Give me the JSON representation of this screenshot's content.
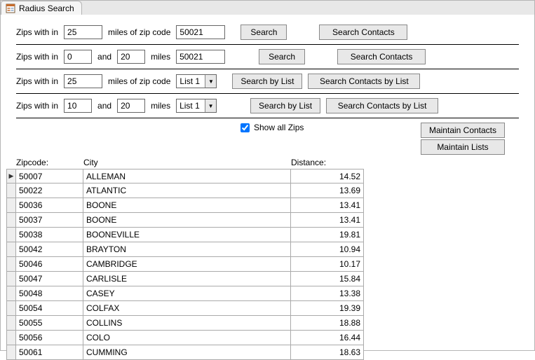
{
  "tab": {
    "title": "Radius Search"
  },
  "row1": {
    "label1": "Zips with in",
    "miles": "25",
    "label2": "miles of zip code",
    "zip": "50021",
    "search": "Search",
    "searchContacts": "Search Contacts"
  },
  "row2": {
    "label1": "Zips with in",
    "from": "0",
    "and": "and",
    "to": "20",
    "label2": "miles",
    "zip": "50021",
    "search": "Search",
    "searchContacts": "Search Contacts"
  },
  "row3": {
    "label1": "Zips with in",
    "miles": "25",
    "label2": "miles of zip code",
    "list": "List 1",
    "searchByList": "Search by List",
    "searchContactsByList": "Search Contacts by List"
  },
  "row4": {
    "label1": "Zips with in",
    "from": "10",
    "and": "and",
    "to": "20",
    "label2": "miles",
    "list": "List 1",
    "searchByList": "Search by List",
    "searchContactsByList": "Search Contacts by List"
  },
  "controls": {
    "showAll": "Show all Zips",
    "maintainContacts": "Maintain Contacts",
    "maintainLists": "Maintain Lists"
  },
  "headers": {
    "zip": "Zipcode:",
    "city": "City",
    "distance": "Distance:"
  },
  "rows": [
    {
      "zip": "50007",
      "city": "ALLEMAN",
      "dist": "14.52"
    },
    {
      "zip": "50022",
      "city": "ATLANTIC",
      "dist": "13.69"
    },
    {
      "zip": "50036",
      "city": "BOONE",
      "dist": "13.41"
    },
    {
      "zip": "50037",
      "city": "BOONE",
      "dist": "13.41"
    },
    {
      "zip": "50038",
      "city": "BOONEVILLE",
      "dist": "19.81"
    },
    {
      "zip": "50042",
      "city": "BRAYTON",
      "dist": "10.94"
    },
    {
      "zip": "50046",
      "city": "CAMBRIDGE",
      "dist": "10.17"
    },
    {
      "zip": "50047",
      "city": "CARLISLE",
      "dist": "15.84"
    },
    {
      "zip": "50048",
      "city": "CASEY",
      "dist": "13.38"
    },
    {
      "zip": "50054",
      "city": "COLFAX",
      "dist": "19.39"
    },
    {
      "zip": "50055",
      "city": "COLLINS",
      "dist": "18.88"
    },
    {
      "zip": "50056",
      "city": "COLO",
      "dist": "16.44"
    },
    {
      "zip": "50061",
      "city": "CUMMING",
      "dist": "18.63"
    }
  ]
}
